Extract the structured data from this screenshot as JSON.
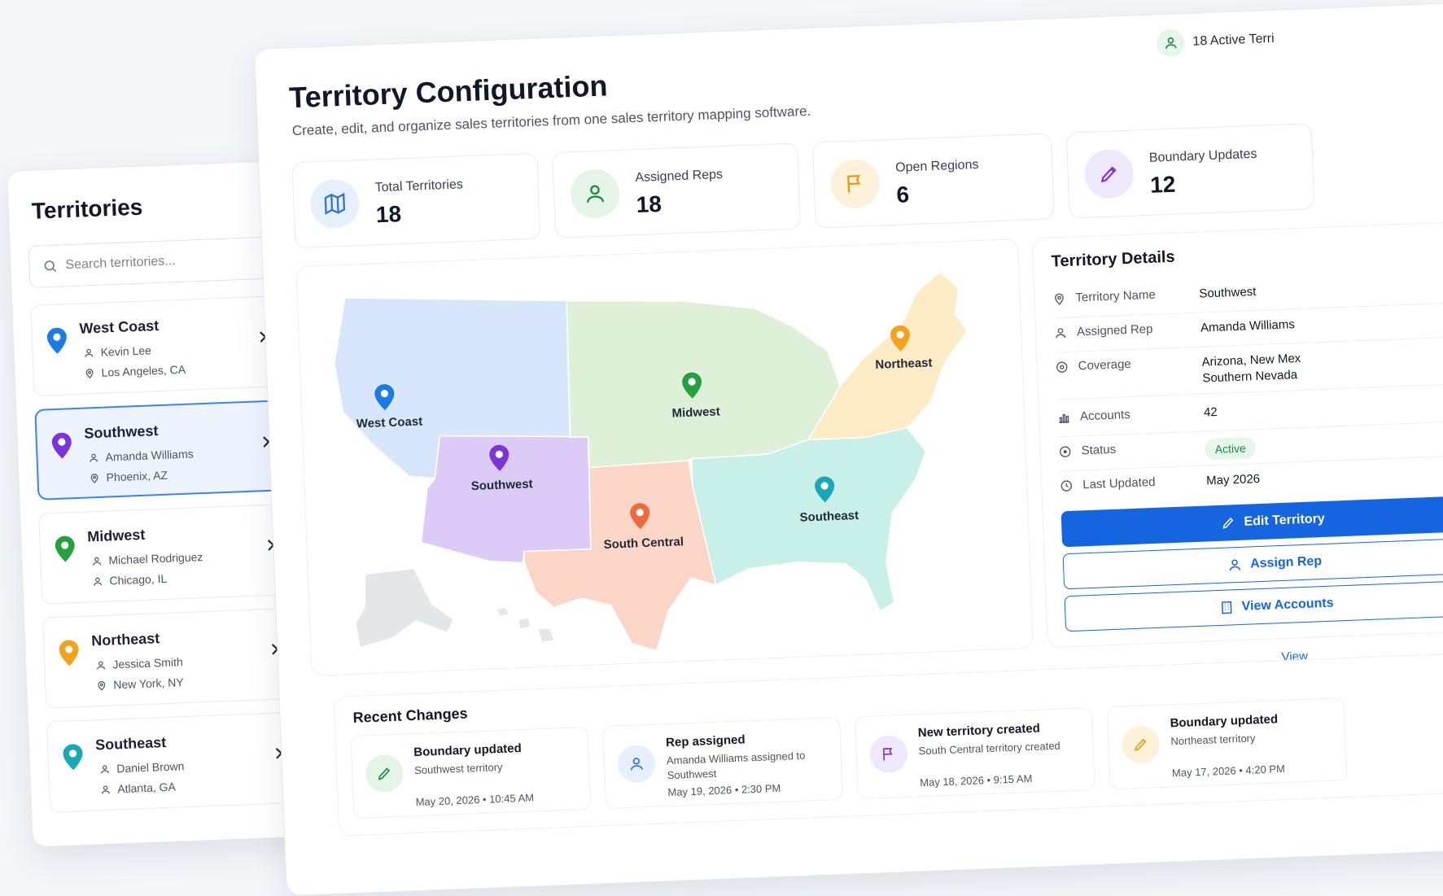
{
  "colors": {
    "primary": "#1565e0",
    "west_coast": "#d8e6fb",
    "southwest": "#dccbf6",
    "midwest": "#dff0d8",
    "northeast": "#fdebc6",
    "south_central": "#fbd5c6",
    "southeast": "#c9efe9",
    "alaska": "#e4e6ea"
  },
  "sidebar": {
    "title": "Territories",
    "search_placeholder": "Search territories...",
    "items": [
      {
        "name": "West Coast",
        "rep": "Kevin Lee",
        "location": "Los Angeles, CA",
        "pin_color": "#1a7ae8"
      },
      {
        "name": "Southwest",
        "rep": "Amanda Williams",
        "location": "Phoenix, AZ",
        "pin_color": "#7b35d6",
        "selected": true
      },
      {
        "name": "Midwest",
        "rep": "Michael Rodriguez",
        "location": "Chicago, IL",
        "pin_color": "#24a03c"
      },
      {
        "name": "Northeast",
        "rep": "Jessica Smith",
        "location": "New York, NY",
        "pin_color": "#f4a21b"
      },
      {
        "name": "Southeast",
        "rep": "Daniel Brown",
        "location": "Atlanta, GA",
        "pin_color": "#1aa7b8"
      }
    ]
  },
  "header": {
    "title": "Territory Configuration",
    "subtitle": "Create, edit, and organize sales territories from one sales territory mapping software.",
    "active_badge": "18 Active Terri"
  },
  "stats": [
    {
      "label": "Total Territories",
      "value": "18",
      "icon": "map-icon",
      "bg": "#e6f0fd",
      "fg": "#2f6fde"
    },
    {
      "label": "Assigned Reps",
      "value": "18",
      "icon": "user-icon",
      "bg": "#e4f5e8",
      "fg": "#228a43"
    },
    {
      "label": "Open Regions",
      "value": "6",
      "icon": "flag-icon",
      "bg": "#fdf1da",
      "fg": "#e89a18"
    },
    {
      "label": "Boundary Updates",
      "value": "12",
      "icon": "pencil-icon",
      "bg": "#efe7fc",
      "fg": "#7b35d6"
    }
  ],
  "map": {
    "regions": {
      "west_coast": "West Coast",
      "southwest": "Southwest",
      "midwest": "Midwest",
      "northeast": "Northeast",
      "south_central": "South Central",
      "southeast": "Southeast"
    }
  },
  "details": {
    "title": "Territory Details",
    "rows": [
      {
        "label": "Territory Name",
        "value": "Southwest",
        "icon": "pin-outline-icon"
      },
      {
        "label": "Assigned Rep",
        "value": "Amanda Williams",
        "icon": "user-outline-icon"
      },
      {
        "label": "Coverage",
        "value": "Arizona, New Mex",
        "value2": "Southern Nevada",
        "icon": "target-icon"
      },
      {
        "label": "Accounts",
        "value": "42",
        "icon": "bar-chart-icon"
      },
      {
        "label": "Status",
        "value": "Active",
        "icon": "status-icon"
      },
      {
        "label": "Last Updated",
        "value": "May 2026",
        "icon": "clock-icon"
      }
    ],
    "buttons": {
      "edit": "Edit Territory",
      "assign": "Assign Rep",
      "view": "View Accounts"
    },
    "view_link": "View"
  },
  "recent": {
    "title": "Recent Changes",
    "items": [
      {
        "title": "Boundary updated",
        "desc": "Southwest territory",
        "time": "May 20, 2026 • 10:45 AM",
        "icon": "pencil-icon",
        "bg": "#e4f5e8",
        "fg": "#228a43"
      },
      {
        "title": "Rep assigned",
        "desc": "Amanda Williams assigned to Southwest",
        "time": "May 19, 2026 • 2:30 PM",
        "icon": "user-icon",
        "bg": "#e6f0fd",
        "fg": "#2f6fde"
      },
      {
        "title": "New territory created",
        "desc": "South Central territory created",
        "time": "May 18, 2026 • 9:15 AM",
        "icon": "flag-icon",
        "bg": "#efe7fc",
        "fg": "#7b35d6"
      },
      {
        "title": "Boundary updated",
        "desc": "Northeast territory",
        "time": "May 17, 2026 • 4:20 PM",
        "icon": "pencil-icon",
        "bg": "#fdf1da",
        "fg": "#e89a18"
      }
    ]
  }
}
